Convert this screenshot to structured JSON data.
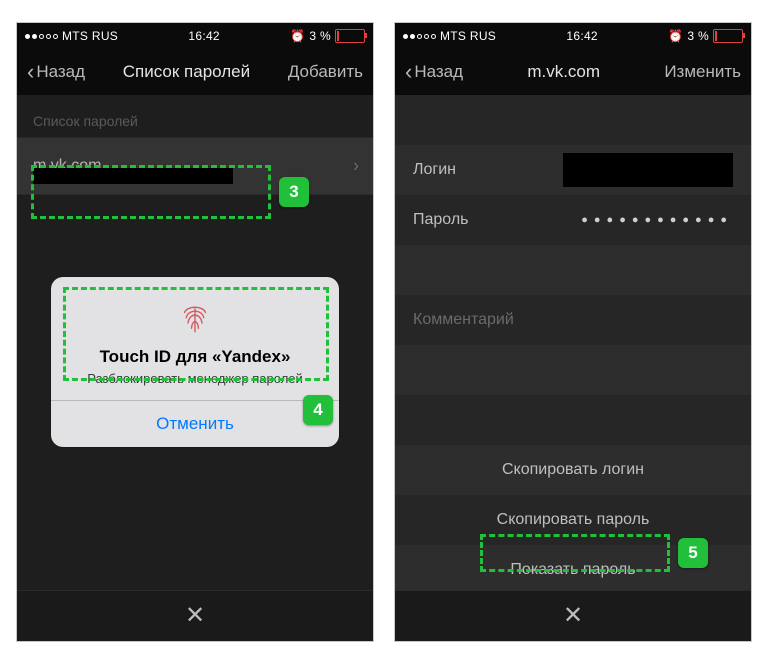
{
  "left": {
    "status": {
      "carrier": "MTS RUS",
      "time": "16:42",
      "battery": "3 %"
    },
    "nav": {
      "back": "Назад",
      "title": "Список паролей",
      "action": "Добавить"
    },
    "sectionLabel": "Список паролей",
    "entry": {
      "site": "m.vk.com"
    },
    "alert": {
      "title": "Touch ID для «Yandex»",
      "subtitle": "Разблокировать менеджер паролей",
      "cancel": "Отменить"
    }
  },
  "right": {
    "status": {
      "carrier": "MTS RUS",
      "time": "16:42",
      "battery": "3 %"
    },
    "nav": {
      "back": "Назад",
      "title": "m.vk.com",
      "action": "Изменить"
    },
    "fields": {
      "login": "Логин",
      "password": "Пароль",
      "passwordMask": "●●●●●●●●●●●●",
      "comment": "Комментарий"
    },
    "actions": {
      "copyLogin": "Скопировать логин",
      "copyPassword": "Скопировать пароль",
      "showPassword": "Показать пароль"
    }
  },
  "annotations": {
    "b3": "3",
    "b4": "4",
    "b5": "5"
  }
}
